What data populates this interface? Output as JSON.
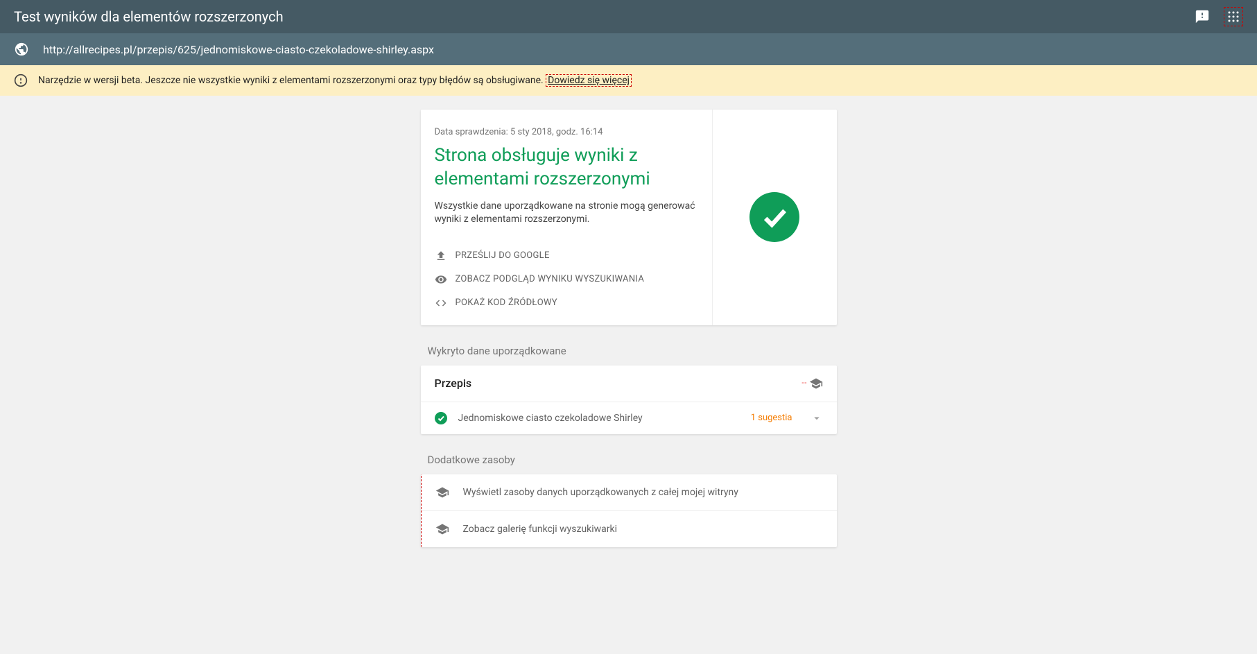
{
  "header": {
    "title": "Test wyników dla elementów rozszerzonych",
    "url": "http://allrecipes.pl/przepis/625/jednomiskowe-ciasto-czekoladowe-shirley.aspx"
  },
  "banner": {
    "text": "Narzędzie w wersji beta. Jeszcze nie wszystkie wyniki z elementami rozszerzonymi oraz typy błędów są obsługiwane. ",
    "link": "Dowiedz się więcej"
  },
  "result": {
    "timestamp": "Data sprawdzenia: 5 sty 2018, godz. 16:14",
    "headline": "Strona obsługuje wyniki z elementami rozszerzonymi",
    "description": "Wszystkie dane uporządkowane na stronie mogą generować wyniki z elementami rozszerzonymi.",
    "actions": {
      "submit": "PRZEŚLIJ DO GOOGLE",
      "preview": "ZOBACZ PODGLĄD WYNIKU WYSZUKIWANIA",
      "source": "POKAŻ KOD ŹRÓDŁOWY"
    }
  },
  "structured": {
    "section_label": "Wykryto dane uporządkowane",
    "type": "Przepis",
    "item_title": "Jednomiskowe ciasto czekoladowe Shirley",
    "suggestion": "1 sugestia"
  },
  "resources": {
    "section_label": "Dodatkowe zasoby",
    "row1": "Wyświetl zasoby danych uporządkowanych z całej mojej witryny",
    "row2": "Zobacz galerię funkcji wyszukiwarki"
  }
}
